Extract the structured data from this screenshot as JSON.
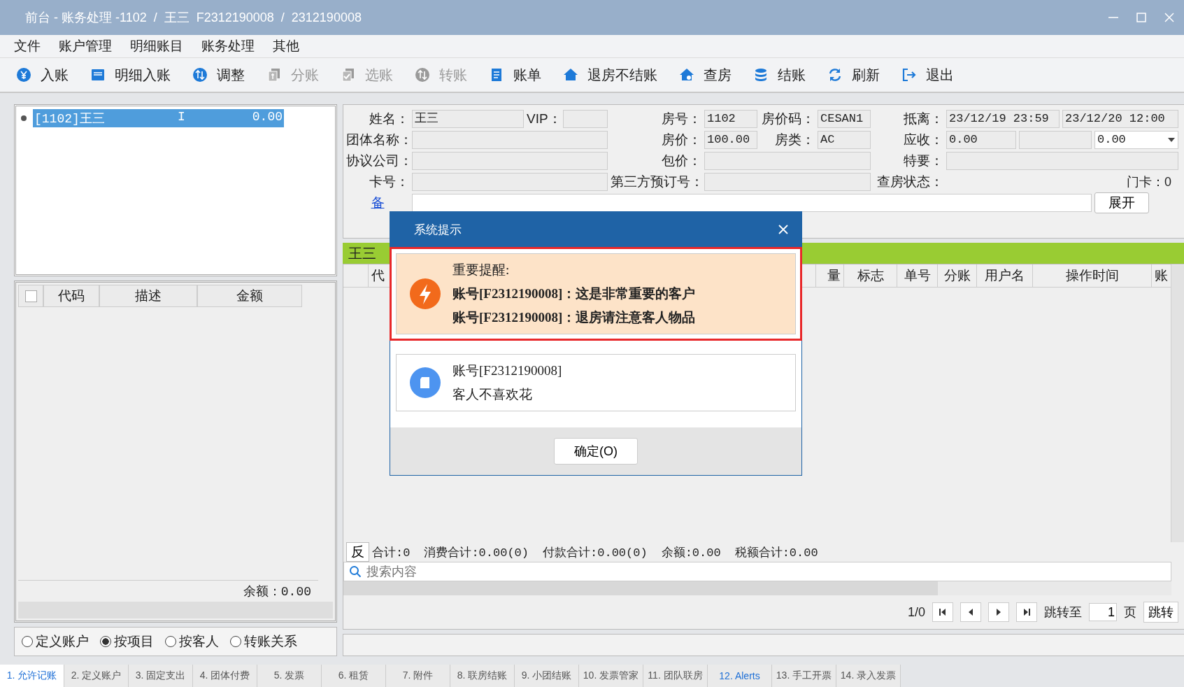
{
  "window": {
    "title": "前台 - 账务处理 -1102  /  王三  F2312190008  /  2312190008"
  },
  "menu": [
    "文件",
    "账户管理",
    "明细账目",
    "账务处理",
    "其他"
  ],
  "toolbar": [
    {
      "label": "入账",
      "disabled": false
    },
    {
      "label": "明细入账",
      "disabled": false
    },
    {
      "label": "调整",
      "disabled": false
    },
    {
      "label": "分账",
      "disabled": true
    },
    {
      "label": "选账",
      "disabled": true
    },
    {
      "label": "转账",
      "disabled": true
    },
    {
      "label": "账单",
      "disabled": false
    },
    {
      "label": "退房不结账",
      "disabled": false
    },
    {
      "label": "查房",
      "disabled": false
    },
    {
      "label": "结账",
      "disabled": false
    },
    {
      "label": "刷新",
      "disabled": false
    },
    {
      "label": "退出",
      "disabled": false
    }
  ],
  "account_list": [
    {
      "name": "[1102]王三",
      "flag": "I",
      "amount": "0.00",
      "selected": true
    }
  ],
  "item_table": {
    "select_all": false,
    "columns": [
      "代码",
      "描述",
      "金额"
    ],
    "balance": "余额：0.00"
  },
  "view_options": [
    {
      "label": "定义账户",
      "selected": false
    },
    {
      "label": "按项目",
      "selected": true
    },
    {
      "label": "按客人",
      "selected": false
    },
    {
      "label": "转账关系",
      "selected": false
    }
  ],
  "form": {
    "fields": [
      {
        "label": "姓名：",
        "boxes": [
          {
            "kind": "text",
            "value": "王三"
          }
        ]
      },
      {
        "label": "VIP：",
        "boxes": [
          {
            "kind": "text"
          }
        ]
      },
      {
        "label": "房号：",
        "boxes": [
          {
            "kind": "text",
            "value": "1102"
          }
        ]
      },
      {
        "label": "房价码：",
        "boxes": [
          {
            "kind": "text",
            "value": "CESAN1"
          }
        ]
      },
      {
        "label": "抵离：",
        "boxes": [
          {
            "kind": "text",
            "value": "23/12/19 23:59"
          },
          {
            "kind": "text",
            "value": "23/12/20 12:00"
          }
        ]
      },
      {
        "label": "团体名称：",
        "boxes": [
          {
            "kind": "text"
          }
        ]
      },
      {
        "label": "房价：",
        "boxes": [
          {
            "kind": "text",
            "value": "100.00"
          }
        ]
      },
      {
        "label": "房类：",
        "boxes": [
          {
            "kind": "text",
            "value": "AC"
          }
        ]
      },
      {
        "label": "应收：",
        "boxes": [
          {
            "kind": "text",
            "value": "0.00"
          },
          {
            "kind": "text"
          },
          {
            "kind": "combo",
            "value": "0.00"
          }
        ]
      },
      {
        "label": "协议公司：",
        "boxes": [
          {
            "kind": "text"
          }
        ]
      },
      {
        "label": "包价：",
        "boxes": [
          {
            "kind": "text"
          }
        ]
      },
      {
        "label": "特要：",
        "boxes": [
          {
            "kind": "text"
          }
        ]
      },
      {
        "label": "卡号：",
        "boxes": [
          {
            "kind": "text"
          }
        ]
      },
      {
        "label": "第三方预订号：",
        "boxes": [
          {
            "kind": "text"
          }
        ]
      },
      {
        "label": "查房状态："
      }
    ],
    "door_card": "门卡：0",
    "remark_link": "备",
    "expand_button": "展开"
  },
  "guest_bar": "王三",
  "grid": {
    "columns": [
      "代",
      "量",
      "标志",
      "单号",
      "分账",
      "用户名",
      "操作时间",
      "账"
    ]
  },
  "summary": {
    "reverse_button": "反",
    "totals": [
      "合计:0",
      "消费合计:0.00(0)",
      "付款合计:0.00(0)",
      "余额:0.00",
      "税额合计:0.00"
    ]
  },
  "search": {
    "placeholder": "搜索内容"
  },
  "pager": {
    "page_info": "1/0",
    "jump_label": "跳转至",
    "page_value": "1",
    "page_unit": "页",
    "jump_button": "跳转"
  },
  "bottom_tabs": [
    {
      "label": "1. 允许记账",
      "selected": true,
      "highlight": false
    },
    {
      "label": "2. 定义账户",
      "selected": false,
      "highlight": false
    },
    {
      "label": "3. 固定支出",
      "selected": false,
      "highlight": false
    },
    {
      "label": "4. 团体付费",
      "selected": false,
      "highlight": false
    },
    {
      "label": "5. 发票",
      "selected": false,
      "highlight": false
    },
    {
      "label": "6. 租赁",
      "selected": false,
      "highlight": false
    },
    {
      "label": "7. 附件",
      "selected": false,
      "highlight": false
    },
    {
      "label": "8. 联房结账",
      "selected": false,
      "highlight": false
    },
    {
      "label": "9. 小团结账",
      "selected": false,
      "highlight": false
    },
    {
      "label": "10. 发票管家",
      "selected": false,
      "highlight": false
    },
    {
      "label": "11. 团队联房",
      "selected": false,
      "highlight": false
    },
    {
      "label": "12. Alerts",
      "selected": false,
      "highlight": true
    },
    {
      "label": "13. 手工开票",
      "selected": false,
      "highlight": false
    },
    {
      "label": "14. 录入发票",
      "selected": false,
      "highlight": false
    }
  ],
  "dialog": {
    "title": "系统提示",
    "cards": [
      {
        "kind": "important",
        "highlight": true,
        "lines": [
          {
            "text": "重要提醒:",
            "bold": false
          },
          {
            "text": "账号[F2312190008]：这是非常重要的客户",
            "bold": true
          },
          {
            "text": "账号[F2312190008]：退房请注意客人物品",
            "bold": true
          }
        ]
      },
      {
        "kind": "note",
        "highlight": false,
        "lines": [
          {
            "text": "账号[F2312190008]",
            "bold": false
          },
          {
            "text": "客人不喜欢花",
            "bold": false
          }
        ]
      }
    ],
    "ok_button": "确定(O)"
  }
}
